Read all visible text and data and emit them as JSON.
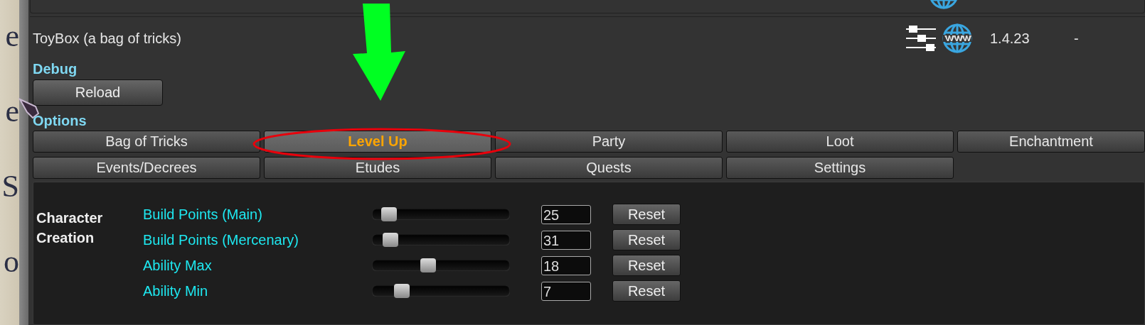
{
  "background_letters": [
    "e",
    "e",
    "S",
    "o"
  ],
  "mod": {
    "name": "ToyBox (a bag of tricks)",
    "version": "1.4.23",
    "column_4": "-"
  },
  "debug": {
    "heading": "Debug",
    "button": "Reload"
  },
  "options": {
    "heading": "Options",
    "tabs": [
      {
        "label": "Bag of Tricks",
        "selected": false
      },
      {
        "label": "Level Up",
        "selected": true
      },
      {
        "label": "Party",
        "selected": false
      },
      {
        "label": "Loot",
        "selected": false
      },
      {
        "label": "Enchantment",
        "selected": false
      },
      {
        "label": "Events/Decrees",
        "selected": false
      },
      {
        "label": "Etudes",
        "selected": false
      },
      {
        "label": "Quests",
        "selected": false
      },
      {
        "label": "Settings",
        "selected": false
      }
    ]
  },
  "section": {
    "heading": "Character Creation",
    "settings": [
      {
        "label": "Build Points (Main)",
        "level": 0.09,
        "value": "25",
        "button": "Reset"
      },
      {
        "label": "Build Points (Mercenary)",
        "level": 0.1,
        "value": "31",
        "button": "Reset"
      },
      {
        "label": "Ability Max",
        "level": 0.37,
        "value": "18",
        "button": "Reset"
      },
      {
        "label": "Ability Min",
        "level": 0.18,
        "value": "7",
        "button": "Reset"
      }
    ]
  }
}
